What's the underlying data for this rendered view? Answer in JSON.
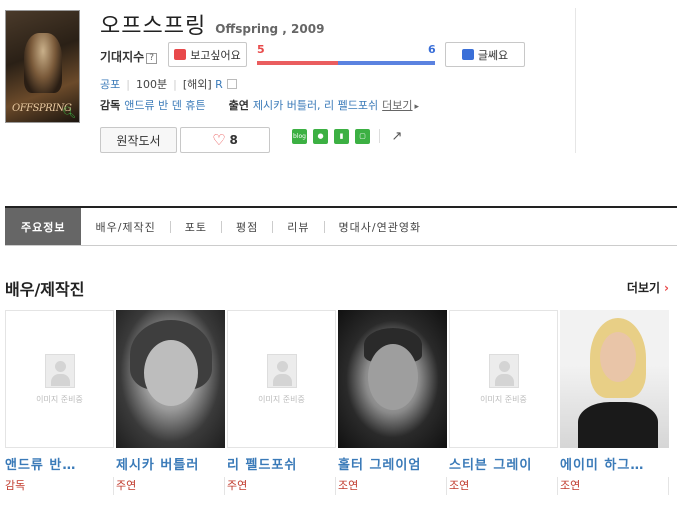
{
  "movie": {
    "title_ko": "오프스프링",
    "title_en_year": "Offspring , 2009",
    "poster_title": "OFFSPRING"
  },
  "expectation": {
    "label": "기대지수",
    "help": "?",
    "want_label": "보고싶어요",
    "meh_label": "글쎄요",
    "want_count": "5",
    "meh_count": "6",
    "want_ratio": 0.455,
    "meh_ratio": 0.545
  },
  "meta": {
    "genre": "공포",
    "runtime": "100분",
    "country": "[해외]",
    "rating": "R"
  },
  "credits": {
    "director_label": "감독",
    "director": "앤드류 반 덴 휴튼",
    "cast_label": "출연",
    "cast": "제시카 버틀러, 리 펠드포쉬",
    "more": "더보기"
  },
  "actions": {
    "original_book": "원작도서",
    "like_count": "8"
  },
  "share": {
    "blog": "blog",
    "icons": [
      "blog-icon",
      "cafe-icon",
      "bookmark-icon",
      "memo-icon",
      "share-icon"
    ]
  },
  "tabs": [
    "주요정보",
    "배우/제작진",
    "포토",
    "평점",
    "리뷰",
    "명대사/연관영화"
  ],
  "section": {
    "title": "배우/제작진",
    "more": "더보기"
  },
  "placeholder_text": "이미지 준비중",
  "cast_list": [
    {
      "name": "앤드류 반…",
      "role": "감독",
      "photo": "empty"
    },
    {
      "name": "제시카 버틀러",
      "role": "주연",
      "photo": "girl"
    },
    {
      "name": "리 펠드포쉬",
      "role": "주연",
      "photo": "empty"
    },
    {
      "name": "홀터 그레이엄",
      "role": "조연",
      "photo": "man"
    },
    {
      "name": "스티븐 그레이",
      "role": "조연",
      "photo": "empty"
    },
    {
      "name": "에이미 하그…",
      "role": "조연",
      "photo": "woman"
    }
  ],
  "colors": {
    "want": "#ea5d5f",
    "meh": "#5b82e0",
    "link": "#3a7ab8",
    "role": "#c0392b",
    "active_tab": "#666666"
  }
}
